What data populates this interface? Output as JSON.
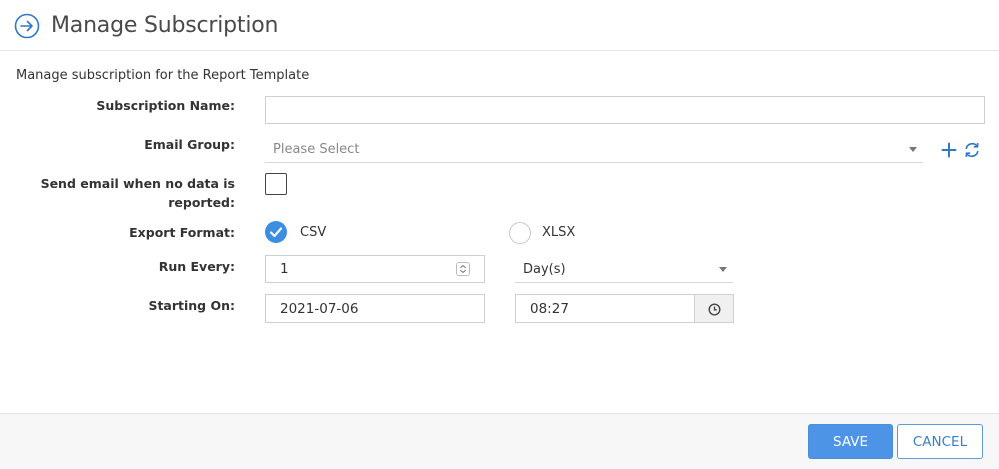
{
  "header": {
    "title": "Manage Subscription",
    "icon": "arrow-circle-right-icon"
  },
  "subtitle": "Manage subscription for the Report Template",
  "form": {
    "subscription_name": {
      "label": "Subscription Name:",
      "value": ""
    },
    "email_group": {
      "label": "Email Group:",
      "placeholder": "Please Select",
      "add_icon": "plus-icon",
      "refresh_icon": "refresh-icon"
    },
    "send_empty": {
      "label_line1": "Send email when no data is",
      "label_line2": "reported:",
      "checked": false
    },
    "export_format": {
      "label": "Export Format:",
      "options": [
        {
          "label": "CSV",
          "selected": true
        },
        {
          "label": "XLSX",
          "selected": false
        }
      ]
    },
    "run_every": {
      "label": "Run Every:",
      "value": "1",
      "unit": "Day(s)"
    },
    "starting_on": {
      "label": "Starting On:",
      "date": "2021-07-06",
      "time": "08:27",
      "time_icon": "clock-icon"
    }
  },
  "footer": {
    "save_label": "SAVE",
    "cancel_label": "CANCEL"
  },
  "colors": {
    "accent": "#4d94e6",
    "check": "#3c8fe0"
  }
}
